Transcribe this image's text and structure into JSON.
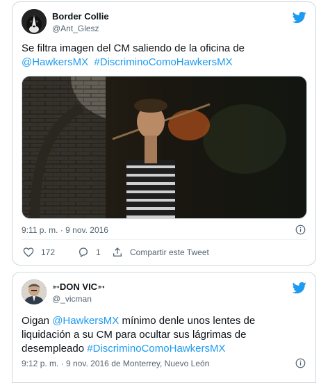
{
  "tweet1": {
    "author_name": "Border Collie",
    "author_handle": "@Ant_Glesz",
    "text_plain": "Se filtra imagen del CM saliendo de la oficina de",
    "mention": "@HawkersMX",
    "hashtag": "#DiscriminoComoHawkersMX",
    "timestamp": "9:11 p. m. · 9 nov. 2016",
    "likes": "172",
    "replies": "1",
    "share_label": "Compartir este Tweet"
  },
  "tweet2": {
    "author_name": "➳DON VIC➳",
    "author_handle": "@_vicman",
    "text_prefix": "Oigan",
    "mention": "@HawkersMX",
    "text_middle": "mínimo denle unos lentes de liquidación a su CM para ocultar sus lágrimas de desempleado",
    "hashtag": "#DiscriminoComoHawkersMX",
    "timestamp": "9:12 p. m. · 9 nov. 2016 de Monterrey, Nuevo León"
  },
  "colors": {
    "link": "#1d9bf0",
    "muted": "#536471",
    "border": "#cfd9de"
  },
  "icons": [
    "twitter-bird-icon",
    "info-icon",
    "heart-icon",
    "reply-icon",
    "share-icon"
  ]
}
